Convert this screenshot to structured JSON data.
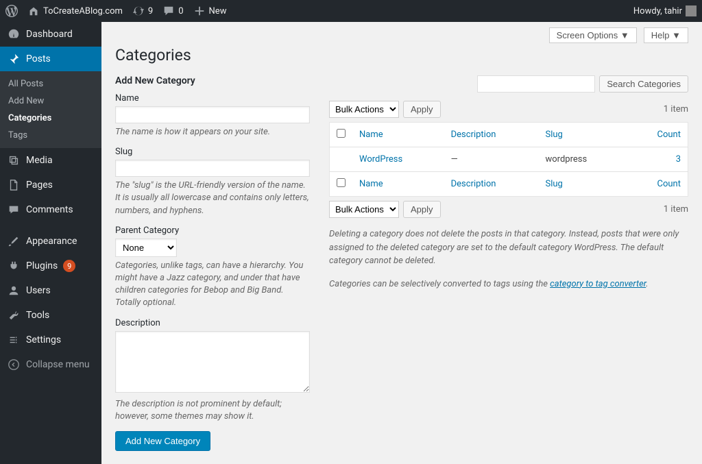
{
  "adminbar": {
    "site_name": "ToCreateABlog.com",
    "updates_count": "9",
    "comments_count": "0",
    "new_label": "New",
    "greeting": "Howdy, tahir"
  },
  "sidebar": {
    "dashboard": "Dashboard",
    "posts": "Posts",
    "posts_sub": {
      "all": "All Posts",
      "add_new": "Add New",
      "categories": "Categories",
      "tags": "Tags"
    },
    "media": "Media",
    "pages": "Pages",
    "comments": "Comments",
    "appearance": "Appearance",
    "plugins": "Plugins",
    "plugins_badge": "9",
    "users": "Users",
    "tools": "Tools",
    "settings": "Settings",
    "collapse": "Collapse menu"
  },
  "screen": {
    "screen_options": "Screen Options",
    "help": "Help",
    "page_title": "Categories"
  },
  "form": {
    "title": "Add New Category",
    "name_label": "Name",
    "name_help": "The name is how it appears on your site.",
    "slug_label": "Slug",
    "slug_help": "The \"slug\" is the URL-friendly version of the name. It is usually all lowercase and contains only letters, numbers, and hyphens.",
    "parent_label": "Parent Category",
    "parent_value": "None",
    "parent_help": "Categories, unlike tags, can have a hierarchy. You might have a Jazz category, and under that have children categories for Bebop and Big Band. Totally optional.",
    "desc_label": "Description",
    "desc_help": "The description is not prominent by default; however, some themes may show it.",
    "submit": "Add New Category"
  },
  "list": {
    "search_btn": "Search Categories",
    "bulk_label": "Bulk Actions",
    "apply": "Apply",
    "item_count": "1 item",
    "columns": {
      "name": "Name",
      "description": "Description",
      "slug": "Slug",
      "count": "Count"
    },
    "rows": [
      {
        "name": "WordPress",
        "description": "—",
        "slug": "wordpress",
        "count": "3"
      }
    ],
    "note1": "Deleting a category does not delete the posts in that category. Instead, posts that were only assigned to the deleted category are set to the default category WordPress. The default category cannot be deleted.",
    "note2a": "Categories can be selectively converted to tags using the ",
    "note2_link": "category to tag converter",
    "note2b": "."
  }
}
